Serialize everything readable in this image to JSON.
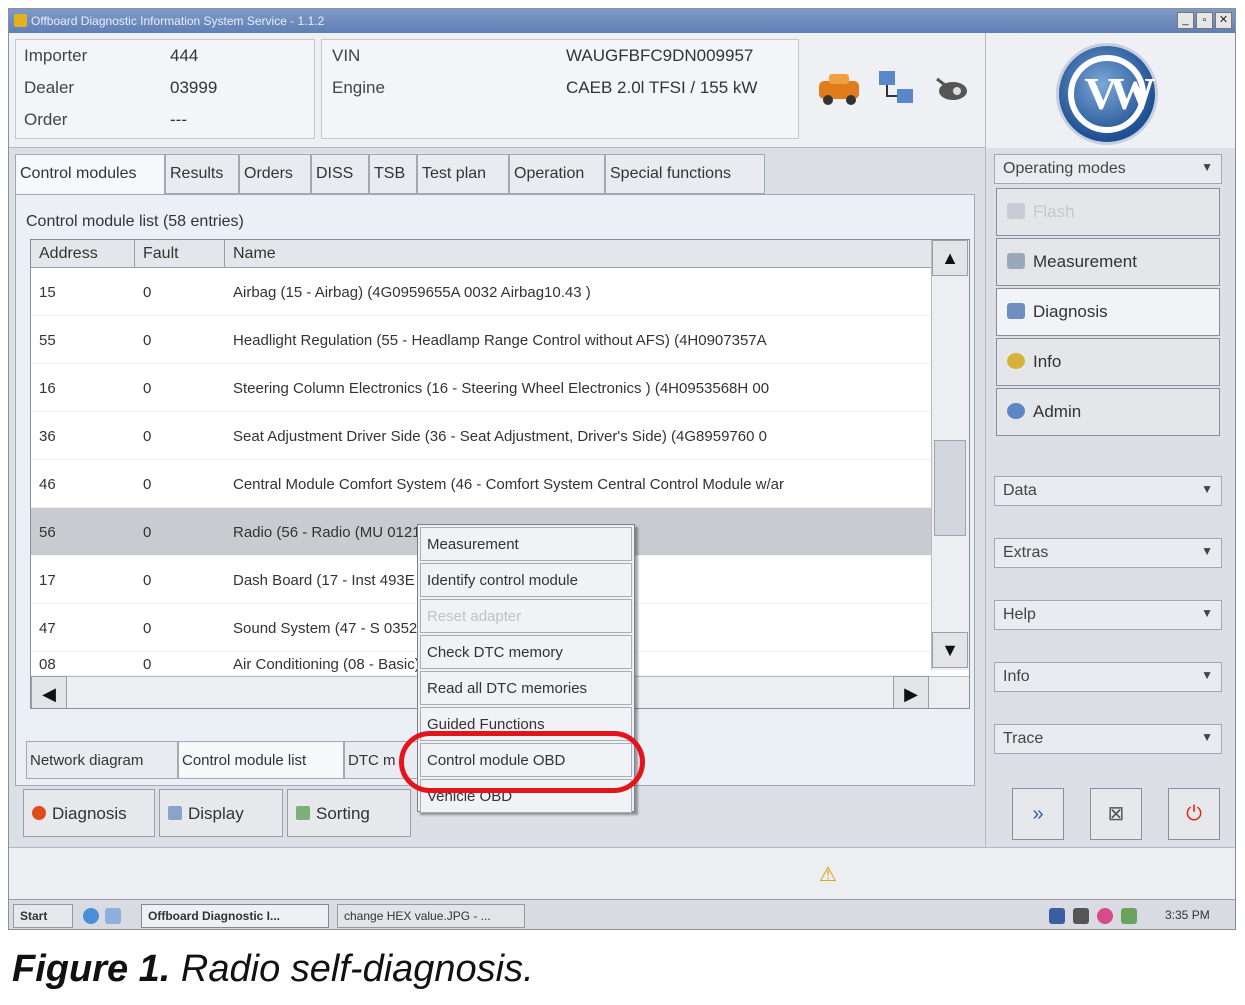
{
  "window": {
    "title": "Offboard Diagnostic Information System Service - 1.1.2",
    "buttons": {
      "minimize": "_",
      "restore": "▫",
      "close": "✕"
    }
  },
  "vehicle_info": {
    "importer_label": "Importer",
    "importer_value": "444",
    "dealer_label": "Dealer",
    "dealer_value": "03999",
    "order_label": "Order",
    "order_value": "---",
    "vin_label": "VIN",
    "vin_value": "WAUGFBFC9DN009957",
    "engine_label": "Engine",
    "engine_value": "CAEB 2.0l TFSI / 155 kW"
  },
  "main_tabs": [
    "Control modules",
    "Results",
    "Orders",
    "DISS",
    "TSB",
    "Test plan",
    "Operation",
    "Special functions"
  ],
  "list": {
    "title": "Control module list (58 entries)",
    "columns": [
      "Address",
      "Fault",
      "Name"
    ],
    "rows": [
      {
        "address": "15",
        "fault": "0",
        "name": "Airbag (15 - Airbag) (4G0959655A    0032   Airbag10.43  )"
      },
      {
        "address": "55",
        "fault": "0",
        "name": "Headlight Regulation (55 - Headlamp Range Control without AFS) (4H0907357A"
      },
      {
        "address": "16",
        "fault": "0",
        "name": "Steering Column Electronics (16 - Steering Wheel Electronics ) (4H0953568H    00"
      },
      {
        "address": "36",
        "fault": "0",
        "name": "Seat Adjustment Driver Side (36 - Seat Adjustment, Driver's Side) (4G8959760    0"
      },
      {
        "address": "46",
        "fault": "0",
        "name": "Central Module Comfort System (46 - Comfort System Central Control Module w/ar"
      },
      {
        "address": "56",
        "fault": "0",
        "name": "Radio (56 - Radio (MU                         0121   Radio U SIRIUS)"
      },
      {
        "address": "17",
        "fault": "0",
        "name": "Dash Board (17 - Inst                            493E    0515   TBenUsa     )"
      },
      {
        "address": "47",
        "fault": "0",
        "name": "Sound System (47 - S                            035223C    0160   BOSE-G3-C7"
      },
      {
        "address": "08",
        "fault": "0",
        "name": "Air Conditioning (08 -                          Basic) (4G0820043AH   0070   KLI"
      }
    ]
  },
  "context_menu": {
    "items": [
      "Measurement",
      "Identify control module",
      "Reset adapter",
      "Check DTC memory",
      "Read all DTC memories",
      "Guided Functions",
      "Control module OBD",
      "Vehicle OBD"
    ],
    "disabled_index": 2
  },
  "sub_tabs": [
    "Network diagram",
    "Control module list",
    "DTC m"
  ],
  "bottom_buttons": {
    "diagnosis": "Diagnosis",
    "display": "Display",
    "sorting": "Sorting"
  },
  "right_panel": {
    "operating_modes_title": "Operating modes",
    "modes": [
      "Flash",
      "Measurement",
      "Diagnosis",
      "Info",
      "Admin"
    ],
    "sections": [
      "Data",
      "Extras",
      "Help",
      "Info",
      "Trace"
    ],
    "expand_arrow": "▼"
  },
  "logo_text": "VW",
  "status": {
    "warning_icon": "⚠"
  },
  "taskbar": {
    "start": "Start",
    "task1": "Offboard Diagnostic I...",
    "task2": "change HEX value.JPG - ...",
    "clock": "3:35 PM"
  },
  "caption": {
    "bold": "Figure 1.",
    "text": " Radio self-diagnosis."
  }
}
